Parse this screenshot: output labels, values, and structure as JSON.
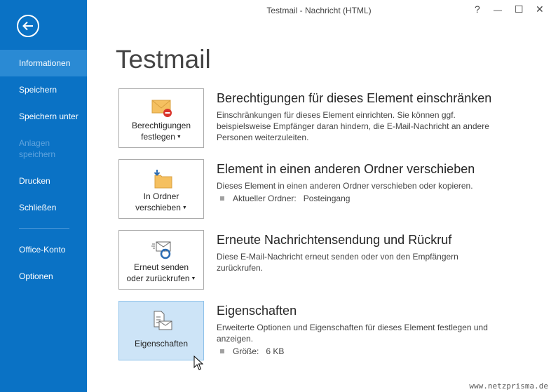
{
  "window": {
    "title": "Testmail - Nachricht (HTML)",
    "help": "?",
    "minimize": "—",
    "maximize": "☐",
    "close": "✕"
  },
  "sidebar": {
    "items": [
      {
        "label": "Informationen"
      },
      {
        "label": "Speichern"
      },
      {
        "label": "Speichern unter"
      },
      {
        "label": "Anlagen speichern"
      },
      {
        "label": "Drucken"
      },
      {
        "label": "Schließen"
      },
      {
        "label": "Office-Konto"
      },
      {
        "label": "Optionen"
      }
    ]
  },
  "page": {
    "title": "Testmail"
  },
  "sections": [
    {
      "button_line1": "Berechtigungen",
      "button_line2": "festlegen",
      "title": "Berechtigungen für dieses Element einschränken",
      "description": "Einschränkungen für dieses Element einrichten. Sie können ggf. beispielsweise Empfänger daran hindern, die E-Mail-Nachricht an andere Personen weiterzuleiten."
    },
    {
      "button_line1": "In Ordner",
      "button_line2": "verschieben",
      "title": "Element in einen anderen Ordner verschieben",
      "description": "Dieses Element in einen anderen Ordner verschieben oder kopieren.",
      "property_label": "Aktueller Ordner:",
      "property_value": "Posteingang"
    },
    {
      "button_line1": "Erneut senden",
      "button_line2": "oder zurückrufen",
      "title": "Erneute Nachrichtensendung und Rückruf",
      "description": "Diese E-Mail-Nachricht erneut senden oder von den Empfängern zurückrufen."
    },
    {
      "button_line1": "Eigenschaften",
      "title": "Eigenschaften",
      "description": "Erweiterte Optionen und Eigenschaften für dieses Element festlegen und anzeigen.",
      "property_label": "Größe:",
      "property_value": "6 KB"
    }
  ],
  "watermark": "www.netzprisma.de"
}
